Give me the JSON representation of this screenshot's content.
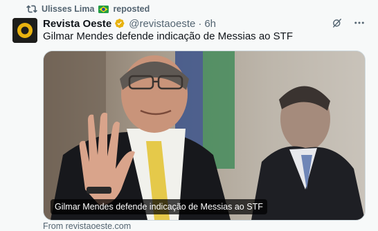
{
  "repost": {
    "user": "Ulisses Lima",
    "flag_icon": "brazil-flag-icon",
    "label": "reposted"
  },
  "tweet": {
    "author_name": "Revista Oeste",
    "verified": true,
    "verified_color": "#e8b20f",
    "handle": "@revistaoeste",
    "separator": "·",
    "time": "6h",
    "text": "Gilmar Mendes defende indicação de Messias ao STF",
    "media": {
      "caption": "Gilmar Mendes defende indicação de Messias ao STF",
      "source": "From revistaoeste.com"
    }
  },
  "colors": {
    "muted": "#536471",
    "text": "#0f1419",
    "background": "#f7f9f9",
    "avatar_ring": "#e8b20f"
  }
}
